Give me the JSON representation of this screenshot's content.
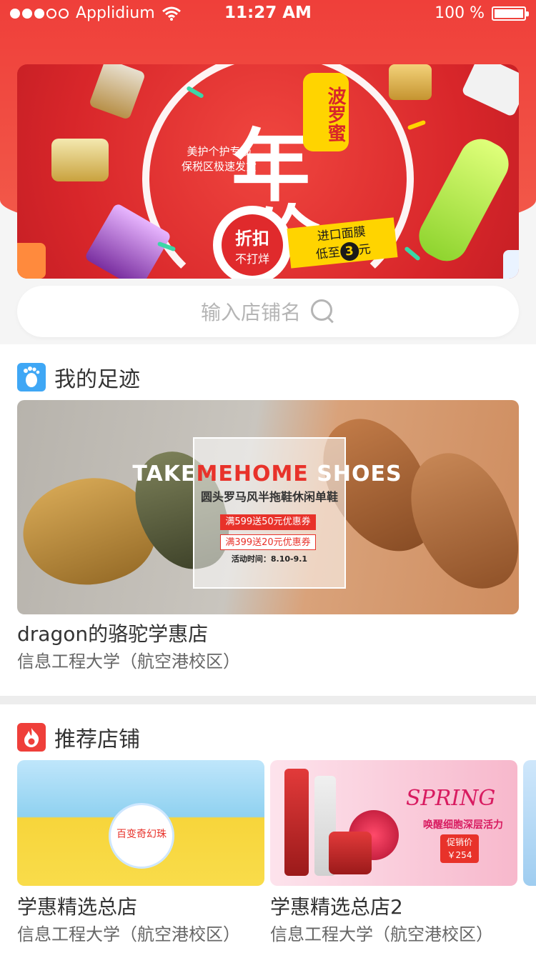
{
  "status_bar": {
    "carrier": "Applidium",
    "time": "11:27 AM",
    "battery": "100 %"
  },
  "banner": {
    "big_char_1": "年",
    "big_char_2": "价",
    "tag": "波罗蜜",
    "subtitle_line1": "美护个护专场",
    "subtitle_line2": "保税区极速发货",
    "discount_main": "折扣",
    "discount_sub": "不打烊",
    "flag_line1": "进口面膜",
    "flag_prefix": "低至",
    "flag_number": "3",
    "flag_suffix": "元"
  },
  "search": {
    "placeholder": "输入店铺名"
  },
  "footprint": {
    "title": "我的足迹",
    "promo_title_pre": "TAKE",
    "promo_title_hl": "MEHOME",
    "promo_title_post": " SHOES",
    "promo_sub": "圆头罗马风半拖鞋休闲单鞋",
    "coupon1": "满599送50元优惠券",
    "coupon2": "满399送20元优惠券",
    "promo_date": "活动时间：8.10-9.1",
    "store_name": "dragon的骆驼学惠店",
    "store_location": "信息工程大学（航空港校区）"
  },
  "recommended": {
    "title": "推荐店铺",
    "stores": [
      {
        "name": "学惠精选总店",
        "location": "信息工程大学（航空港校区）",
        "badge": "百变奇幻珠"
      },
      {
        "name": "学惠精选总店2",
        "location": "信息工程大学（航空港校区）",
        "headline": "SPRING",
        "tagline": "唤醒细胞深层活力",
        "price_label": "促销价",
        "price": "￥254"
      }
    ]
  }
}
